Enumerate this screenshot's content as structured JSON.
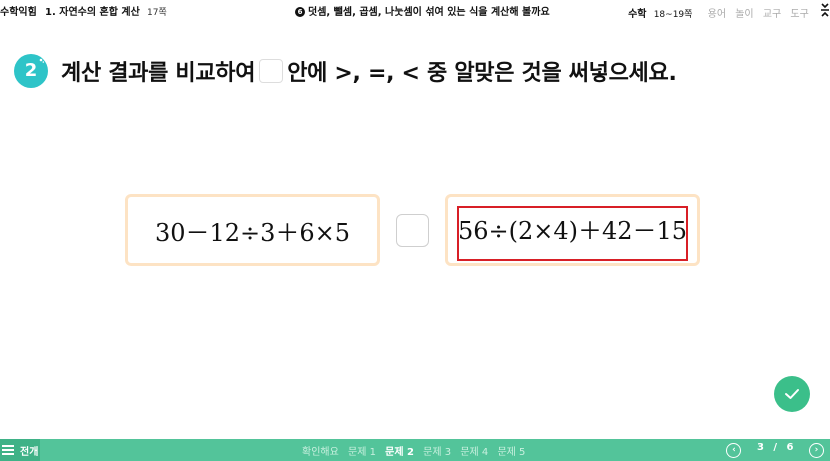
{
  "header": {
    "book": "수학익힘",
    "chapter": "1. 자연수의 혼합 계산",
    "book_page": "17쪽",
    "lesson_num": "6",
    "lesson_title": "덧셈, 뺄셈, 곱셈, 나눗셈이 섞여 있는 식을 계산해 볼까요",
    "subject": "수학",
    "subject_pages": "18~19쪽",
    "tools": [
      "용어",
      "놀이",
      "교구",
      "도구"
    ],
    "expand_icon": "expand-icon"
  },
  "question": {
    "number": "2",
    "text_before": "계산 결과를 비교하여",
    "text_after": "안에 >, =, < 중 알맞은 것을 써넣으세요."
  },
  "expressions": {
    "left": "30－12÷3＋6×5",
    "right": "56÷(2×4)＋42－15"
  },
  "footer": {
    "menu_label": "전개",
    "tabs": [
      "확인해요",
      "문제 1",
      "문제 2",
      "문제 3",
      "문제 4",
      "문제 5"
    ],
    "active_tab": "문제 2",
    "page_current": "3",
    "page_separator": "/",
    "page_total": "6"
  },
  "colors": {
    "accent_teal": "#2ec4c8",
    "footer_green": "#53c49a",
    "check_green": "#3bbf8a",
    "box_border": "#fde3c4",
    "highlight_red": "#d81f26"
  }
}
